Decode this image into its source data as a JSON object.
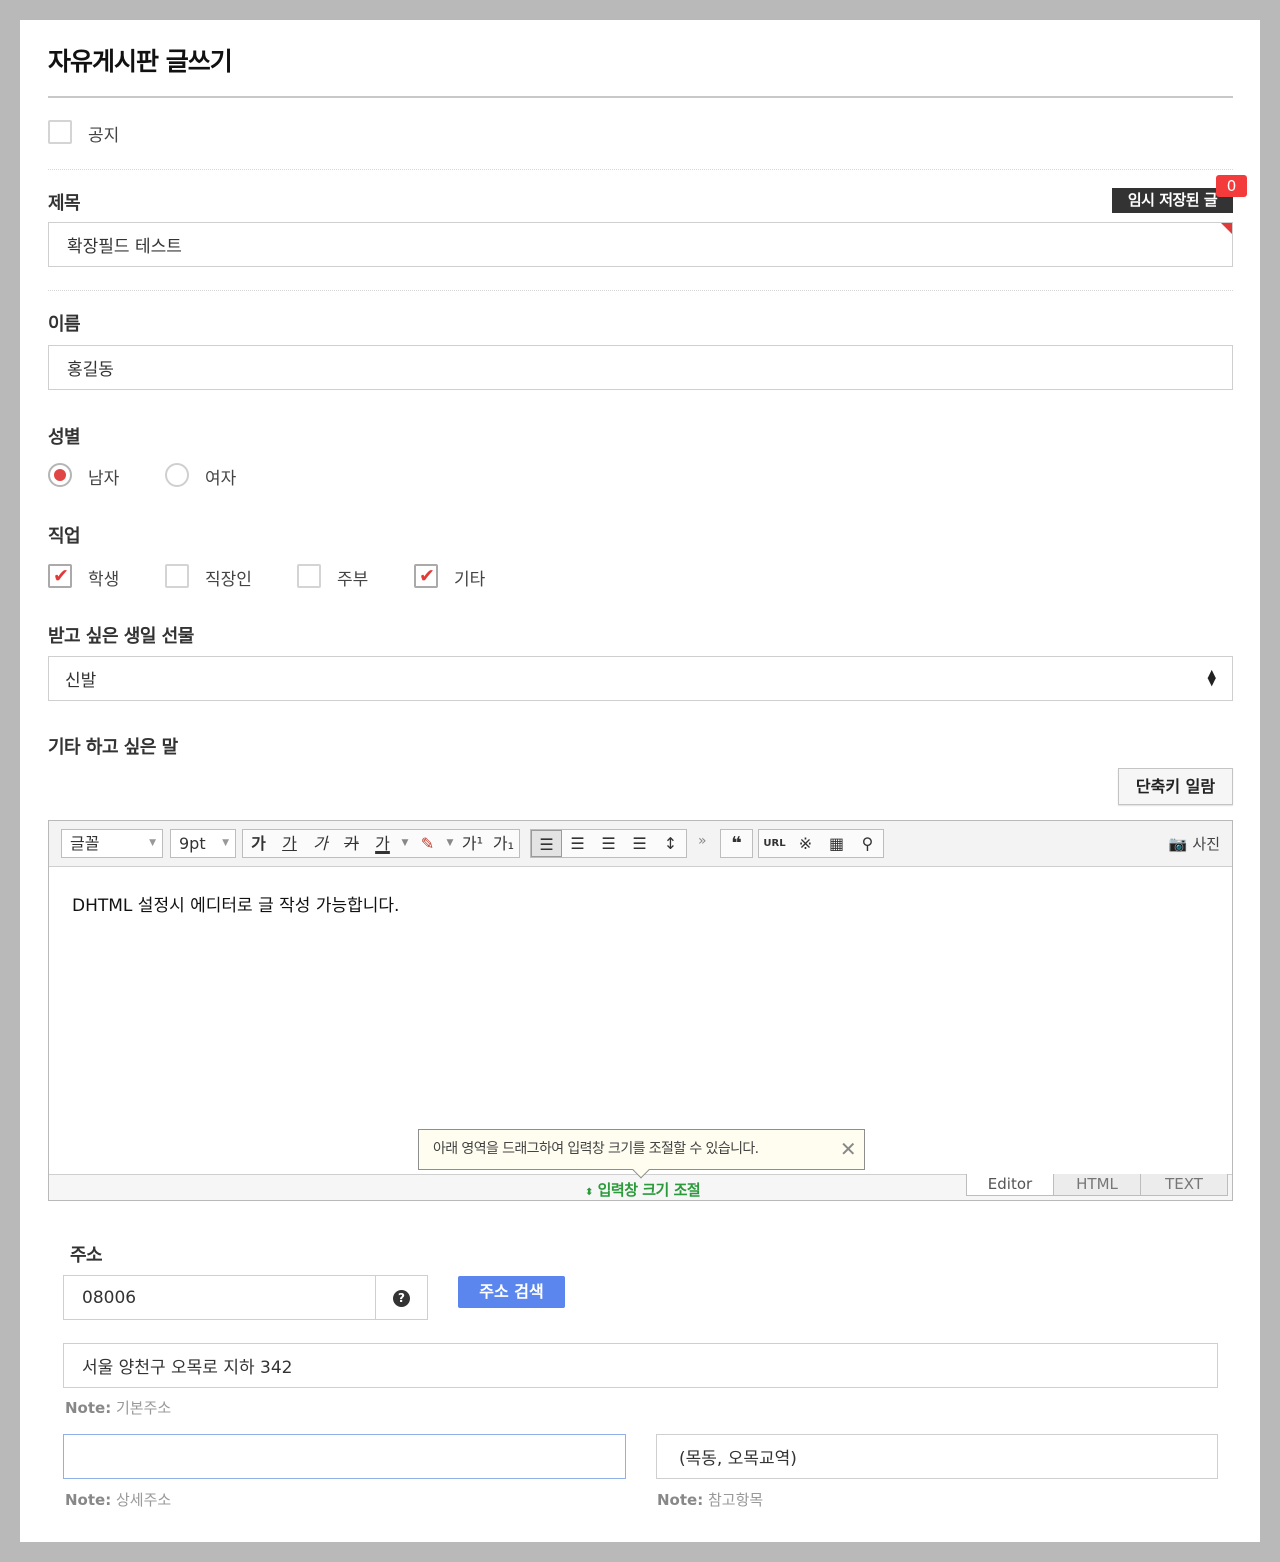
{
  "page": {
    "title": "자유게시판 글쓰기"
  },
  "notice": {
    "label": "공지",
    "checked": false
  },
  "subject": {
    "label": "제목",
    "value": "확장필드 테스트",
    "temp_saved_label": "임시 저장된 글",
    "temp_saved_count": "0"
  },
  "name": {
    "label": "이름",
    "value": "홍길동"
  },
  "gender": {
    "label": "성별",
    "options": [
      {
        "label": "남자",
        "selected": true
      },
      {
        "label": "여자",
        "selected": false
      }
    ]
  },
  "job": {
    "label": "직업",
    "options": [
      {
        "label": "학생",
        "checked": true
      },
      {
        "label": "직장인",
        "checked": false
      },
      {
        "label": "주부",
        "checked": false
      },
      {
        "label": "기타",
        "checked": true
      }
    ]
  },
  "gift": {
    "label": "받고 싶은 생일 선물",
    "selected": "신발"
  },
  "message": {
    "label": "기타 하고 싶은 말",
    "shortcut_button": "단축키 일람",
    "editor": {
      "font_select": "글꼴",
      "size_select": "9pt",
      "format_buttons": [
        "가",
        "가",
        "가",
        "가",
        "가"
      ],
      "superscript": "가¹",
      "subscript": "가₁",
      "url_button": "URL",
      "photo_button": "사진",
      "content": "DHTML 설정시 에디터로 글 작성 가능합니다.",
      "tooltip": "아래 영역을 드래그하여 입력창 크기를 조절할 수 있습니다.",
      "resize_label": "입력창 크기 조절",
      "modes": [
        {
          "label": "Editor",
          "active": true
        },
        {
          "label": "HTML",
          "active": false
        },
        {
          "label": "TEXT",
          "active": false
        }
      ]
    }
  },
  "address": {
    "label": "주소",
    "postcode": "08006",
    "help_icon": "question-circle-icon",
    "search_button": "주소 검색",
    "base": "서울 양천구 오목로 지하 342",
    "base_note_prefix": "Note:",
    "base_note": "기본주소",
    "detail": "",
    "detail_note_prefix": "Note:",
    "detail_note": "상세주소",
    "extra": "(목동, 오목교역)",
    "extra_note_prefix": "Note:",
    "extra_note": "참고항목"
  },
  "colors": {
    "accent": "#5b86ee",
    "check": "#e03a3a",
    "badge": "#f33b3b",
    "resize": "#2a9a3a"
  }
}
